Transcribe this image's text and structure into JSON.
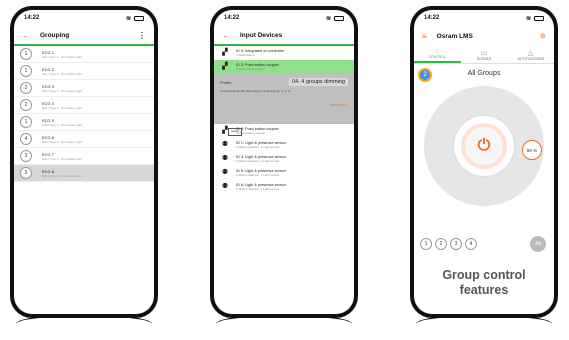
{
  "status": {
    "time": "14:22"
  },
  "phone1": {
    "title": "Grouping",
    "items": [
      {
        "num": "1",
        "name": "ECG 1",
        "sub": "DALI Type 6 - Dimmable Light",
        "selected": false
      },
      {
        "num": "1",
        "name": "ECG 2",
        "sub": "DALI Type 6 - Dimmable Light",
        "selected": false
      },
      {
        "num": "2",
        "name": "ECG 3",
        "sub": "DALI Type 6 - Dimmable Light",
        "selected": false
      },
      {
        "num": "2",
        "name": "ECG 4",
        "sub": "DALI Type 6 - Dimmable Light",
        "selected": false
      },
      {
        "num": "1",
        "name": "ECG 5",
        "sub": "DALI Type 6 - Dimmable Light",
        "selected": false
      },
      {
        "num": "4",
        "name": "ECG 6",
        "sub": "DALI Type 6 - Dimmable Light",
        "selected": false
      },
      {
        "num": "3",
        "name": "ECG 7",
        "sub": "DALI Type 6 - Dimmable Light",
        "selected": false
      },
      {
        "num": "3",
        "name": "ECG 8",
        "sub": "DALI Type 6 - Dimmable Light",
        "selected": true
      }
    ]
  },
  "phone2": {
    "title": "Input Devices",
    "top_devices": [
      {
        "name": "ID 0: Integrated on controller",
        "sub": "1 Push button",
        "selected": false
      },
      {
        "name": "ID 2: Push button coupler",
        "sub": "4 Push button coupler",
        "selected": true
      }
    ],
    "profile_label": "Profile",
    "profile_value": "04. 4 groups dimming",
    "profile_cmd": "Commands for ON (Dimming on 4 Groups (1, 2, 3, 4)",
    "keypad_label": "AAAA",
    "more_info": "More info...",
    "devices": [
      {
        "name": "ID 3: Push button coupler",
        "sub": "4 Push button coupler"
      },
      {
        "name": "ID 1: Light & presence sensor",
        "sub": "1 Motion detector, 1 Light sensor"
      },
      {
        "name": "ID 4: Light & presence sensor",
        "sub": "1 Motion detector, 1 Light sensor"
      },
      {
        "name": "ID 5: Light & presence sensor",
        "sub": "1 Motion detector, 1 Light sensor"
      },
      {
        "name": "ID 6: Light & presence sensor",
        "sub": "1 Motion detector, 1 Light sensor"
      }
    ]
  },
  "phone3": {
    "title": "Osram LMS",
    "tabs": [
      "CONTROL",
      "SCENES",
      "NOTIFICATIONS"
    ],
    "heading": "All Groups",
    "badge": "2",
    "level": "80 %",
    "group_buttons": [
      "1",
      "2",
      "3",
      "4"
    ],
    "all_label": "All",
    "caption_line1": "Group control",
    "caption_line2": "features"
  },
  "colors": {
    "accent": "#f06a1d",
    "green": "#2eb843",
    "selected": "#8ee08a"
  }
}
